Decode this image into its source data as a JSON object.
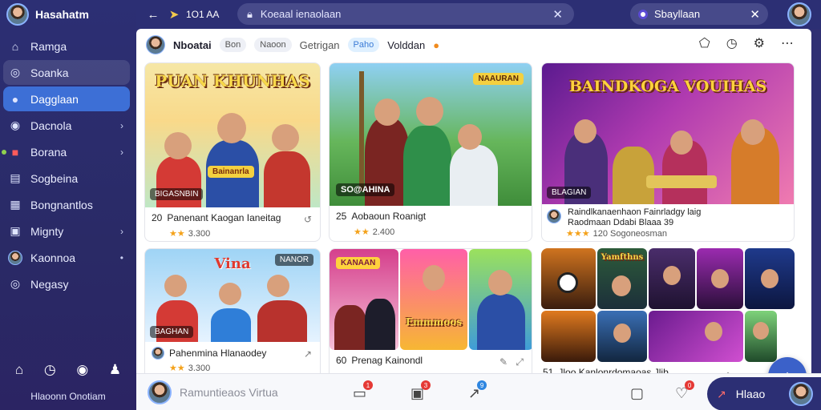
{
  "app": {
    "name": "Hasahatm"
  },
  "sidebar": {
    "items": [
      {
        "label": "Ramga",
        "icon": "home-icon"
      },
      {
        "label": "Soanka",
        "icon": "circle-icon"
      },
      {
        "label": "Dagglaan",
        "icon": "chat-icon"
      },
      {
        "label": "Dacnola",
        "icon": "message-icon"
      },
      {
        "label": "Borana",
        "icon": "video-icon"
      },
      {
        "label": "Sogbeina",
        "icon": "note-icon"
      },
      {
        "label": "Bongnantlos",
        "icon": "grid-icon"
      },
      {
        "label": "Mignty",
        "icon": "image-icon"
      },
      {
        "label": "Kaonnoa",
        "icon": "avatar-icon"
      },
      {
        "label": "Negasy",
        "icon": "settings-icon"
      }
    ],
    "footer": "Hlaoonn Onotiam"
  },
  "topbar": {
    "nav_text": "1O1 AA",
    "search_text": "Koeaal ienaolaan",
    "search2_text": "Sbayllaan"
  },
  "feedbar": {
    "title": "Nboatai",
    "pill1": "Bon",
    "pill2": "Naoon",
    "pill3": "Getrigan",
    "pill4": "Paho",
    "pill5": "Volddan"
  },
  "cards": [
    {
      "thumb_title": "PUAN KHUNHAS",
      "badge": "Bainanrla",
      "badge2": "BIGASNBIN",
      "num": "20",
      "caption": "Panenant Kaogan Ianeitag",
      "meta": "3.300"
    },
    {
      "thumb_title": "",
      "badge": "NAAURAN",
      "badge2": "SO@AHINA",
      "num": "25",
      "caption": "Aobaoun Roanigt",
      "meta": "2.400"
    },
    {
      "thumb_title": "BAINDKOGA VOUIHAS",
      "badge": "BLAGIAN",
      "num": "",
      "caption": "Raindlkanaenhaon Fainrladgy laig",
      "caption2": "Raodmaan Ddabi Blaaa 39",
      "meta": "120 Sogoneosman"
    },
    {
      "thumb_title": "Vina",
      "badge": "NANOR",
      "badge2": "BAGHAN",
      "num": "",
      "caption": "Pahenmina Hlanaodey",
      "meta": "3.300"
    },
    {
      "thumb_title": "Emmmoos",
      "badge": "KANAAN",
      "num": "60",
      "caption": "Prenag Kainondl",
      "meta": ""
    },
    {
      "thumb_title": "",
      "badge": "Yamfthns",
      "num": "51",
      "caption": "Jloo Kanlonrdomaoas Jljb",
      "meta": ""
    }
  ],
  "bottombar": {
    "compose_placeholder": "Ramuntieaos Virtua",
    "profile_name": "Hlaao",
    "badge1": "1",
    "badge2": "3",
    "badge3": "9",
    "badge4": "0"
  }
}
